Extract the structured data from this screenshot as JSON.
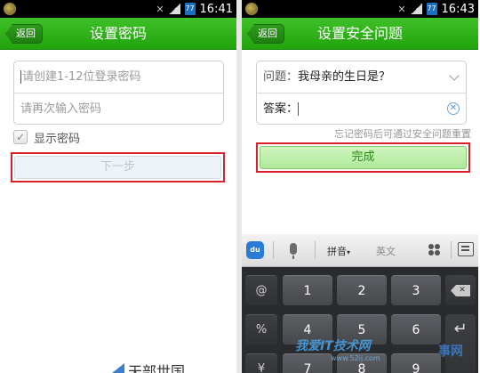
{
  "left": {
    "status_bar": {
      "time": "16:41",
      "battery_level": "77"
    },
    "header": {
      "back_label": "返回",
      "title": "设置密码"
    },
    "form": {
      "password_placeholder": "请创建1-12位登录密码",
      "confirm_placeholder": "请再次输入密码"
    },
    "show_password_label": "显示密码",
    "show_password_checked": true,
    "next_button_label": "下一步"
  },
  "right": {
    "status_bar": {
      "time": "16:43",
      "battery_level": "77"
    },
    "header": {
      "back_label": "返回",
      "title": "设置安全问题"
    },
    "form": {
      "question_label": "问题：",
      "question_value": "我母亲的生日是？",
      "answer_label": "答案："
    },
    "hint": "忘记密码后可通过安全问题重置",
    "done_button_label": "完成",
    "keyboard": {
      "logo": "du",
      "pinyin_label": "拼音",
      "english_label": "英文",
      "side_keys": [
        "@",
        "%",
        "¥"
      ],
      "number_keys": [
        "1",
        "2",
        "3",
        "4",
        "5",
        "6",
        "7",
        "8",
        "9"
      ]
    }
  },
  "watermark": {
    "text": "我爱IT技术网",
    "sub": "www.52ij.com",
    "right_text": "事网"
  },
  "footer_logo_text": "天部世国",
  "colors": {
    "header_green": "#21a30c",
    "highlight_red": "#d9212a",
    "done_green": "#b0e99b"
  }
}
